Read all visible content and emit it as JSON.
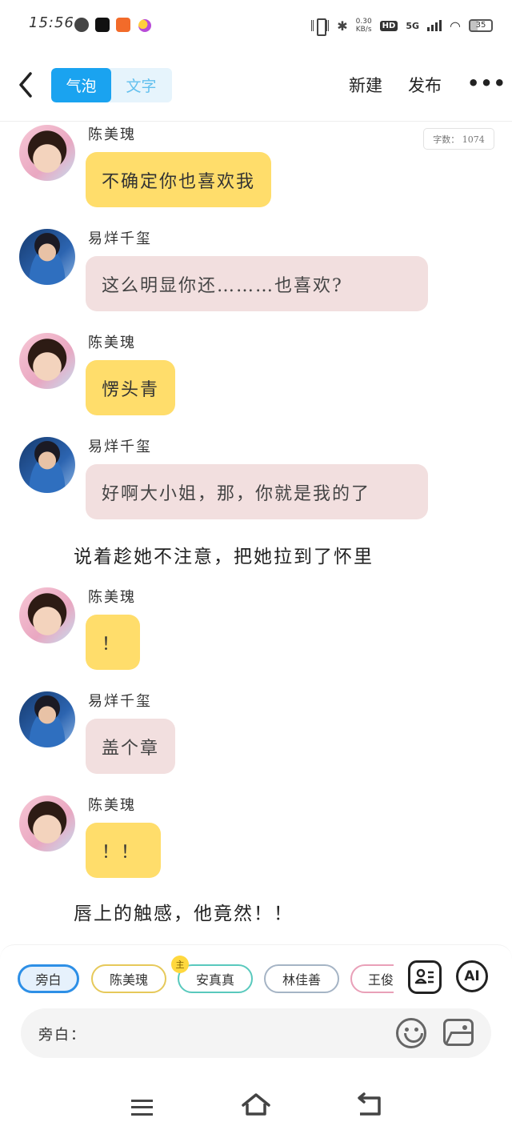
{
  "status_bar": {
    "time": "15:56",
    "net_speed": "0.30",
    "net_unit": "KB/s",
    "hd": "HD",
    "signal": "5G",
    "battery": "35"
  },
  "header": {
    "tabs": [
      {
        "label": "气泡",
        "active": true
      },
      {
        "label": "文字",
        "active": false
      }
    ],
    "new_label": "新建",
    "publish_label": "发布",
    "more_label": "•••"
  },
  "chat": {
    "word_count": "字数： 1074",
    "messages": [
      {
        "speaker": "陈美瑰",
        "text": "不确定你也喜欢我",
        "style": "yellow"
      },
      {
        "speaker": "易烊千玺",
        "text": "这么明显你还………也喜欢?",
        "style": "pink"
      },
      {
        "speaker": "陈美瑰",
        "text": "愣头青",
        "style": "yellow"
      },
      {
        "speaker": "易烊千玺",
        "text": "好啊大小姐，那，你就是我的了",
        "style": "pink"
      },
      {
        "narration": "说着趁她不注意，把她拉到了怀里"
      },
      {
        "speaker": "陈美瑰",
        "text": "！",
        "style": "yellow"
      },
      {
        "speaker": "易烊千玺",
        "text": "盖个章",
        "style": "pink"
      },
      {
        "speaker": "陈美瑰",
        "text": "！！",
        "style": "yellow"
      },
      {
        "narration": "唇上的触感，他竟然！！"
      }
    ]
  },
  "composer": {
    "roles": [
      "旁白",
      "陈美瑰",
      "安真真",
      "林佳善",
      "王俊"
    ],
    "main_badge": "主",
    "ai_label": "AI",
    "input_label": "旁白："
  },
  "colors": {
    "accent": "#1aa3f0",
    "bubble_yellow": "#ffdd6b",
    "bubble_pink": "#f2dfdf"
  },
  "icons": [
    "back-arrow-icon",
    "more-icon",
    "contact-card-icon",
    "emoji-icon",
    "image-icon",
    "menu-icon",
    "home-icon",
    "return-icon"
  ]
}
